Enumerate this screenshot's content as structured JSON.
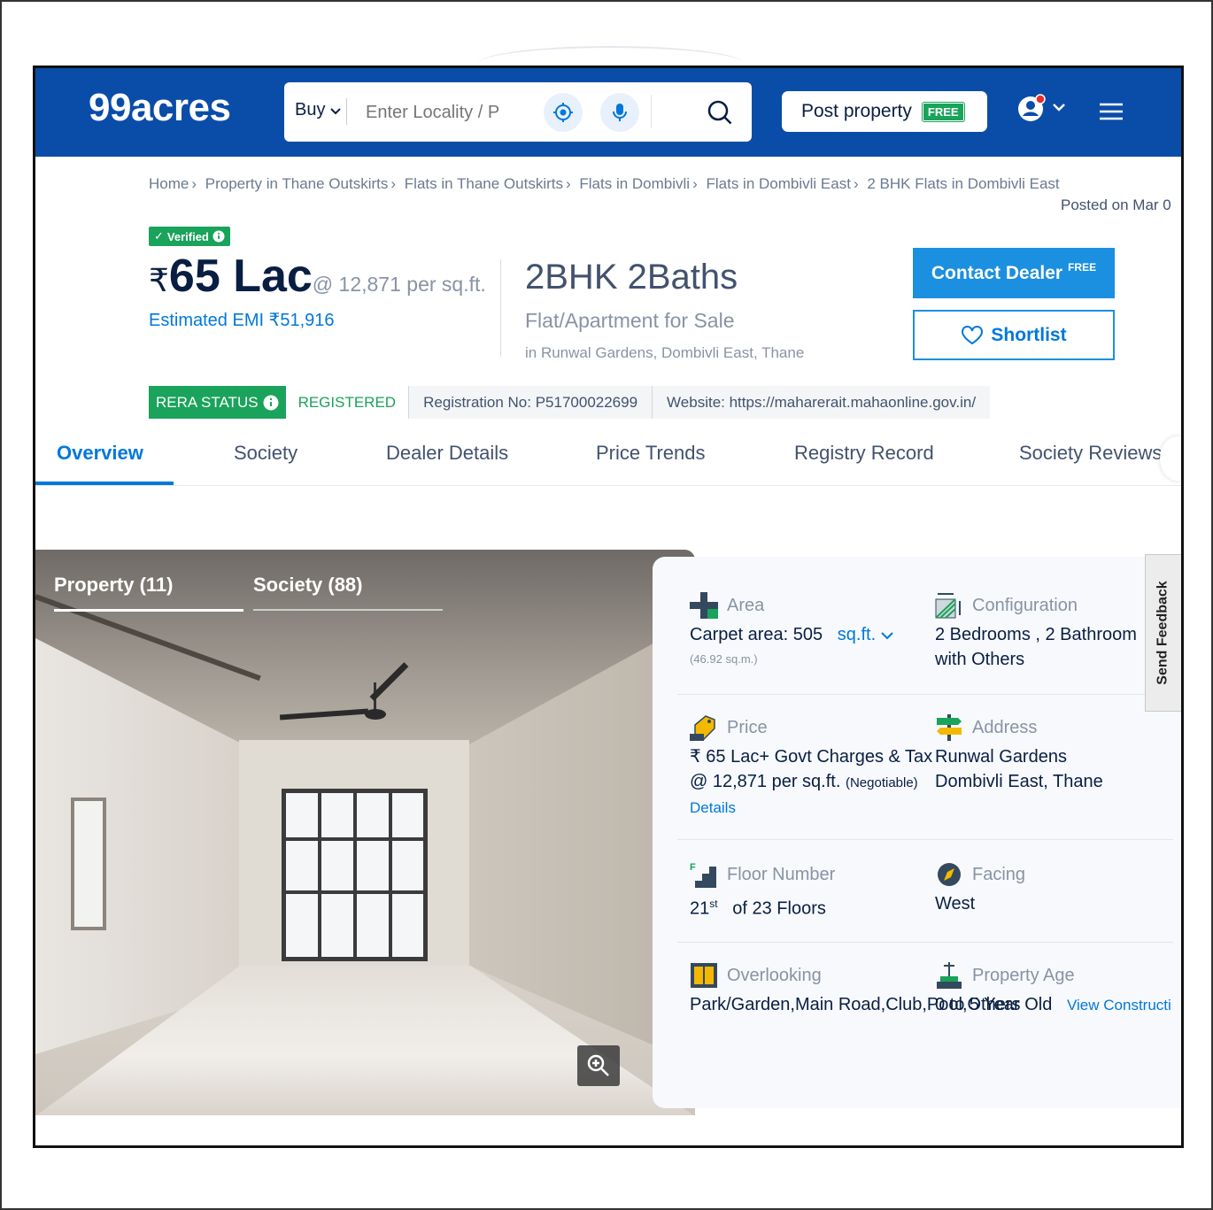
{
  "header": {
    "logo": "99acres",
    "search": {
      "buy_label": "Buy",
      "placeholder": "Enter Locality / P"
    },
    "post_property": {
      "label": "Post property",
      "tag": "FREE"
    },
    "colors": {
      "brand": "#0A4DA8",
      "accent": "#0078DB",
      "green": "#1AA35A"
    }
  },
  "breadcrumb": [
    "Home",
    "Property in Thane Outskirts",
    "Flats in Thane Outskirts",
    "Flats in Dombivli",
    "Flats in Dombivli East",
    "2 BHK Flats in Dombivli East"
  ],
  "posted_on": "Posted on Mar 0",
  "listing": {
    "verified": "Verified",
    "currency": "₹",
    "price": "65 Lac",
    "price_per": "@ 12,871 per sq.ft.",
    "emi": "Estimated EMI ₹51,916",
    "title": "2BHK 2Baths",
    "type": "Flat/Apartment for Sale",
    "location": "in Runwal Gardens, Dombivli East, Thane",
    "contact_label": "Contact Dealer",
    "contact_tag": "FREE",
    "shortlist_label": "Shortlist"
  },
  "rera": {
    "status_label": "RERA STATUS",
    "status_value": "REGISTERED",
    "registration": "Registration No: P51700022699",
    "website": "Website: https://maharerait.mahaonline.gov.in/"
  },
  "tabs": [
    "Overview",
    "Society",
    "Dealer Details",
    "Price Trends",
    "Registry Record",
    "Society Reviews"
  ],
  "gallery": {
    "tab_property": "Property (11)",
    "tab_society": "Society (88)"
  },
  "details": {
    "area": {
      "label": "Area",
      "value": "Carpet area: 505",
      "unit": "sq.ft.",
      "sub": "(46.92 sq.m.)"
    },
    "configuration": {
      "label": "Configuration",
      "line1": "2 Bedrooms , 2 Bathroom",
      "line2": "with Others"
    },
    "price": {
      "label": "Price",
      "line1": "₹ 65 Lac+ Govt Charges & Tax",
      "line2": "@ 12,871 per sq.ft.",
      "negotiable": "(Negotiable)",
      "details_link": "Details"
    },
    "address": {
      "label": "Address",
      "line1": "Runwal Gardens",
      "line2": "Dombivli East, Thane"
    },
    "floor": {
      "label": "Floor Number",
      "floor": "21",
      "suffix": "st",
      "of": "of 23 Floors"
    },
    "facing": {
      "label": "Facing",
      "value": "West"
    },
    "overlooking": {
      "label": "Overlooking",
      "value": "Park/Garden,Main Road,Club,Pool,Others"
    },
    "property_age": {
      "label": "Property Age",
      "value": "0 to 5 Year Old",
      "link": "View Constructi"
    }
  },
  "feedback_label": "Send Feedback"
}
